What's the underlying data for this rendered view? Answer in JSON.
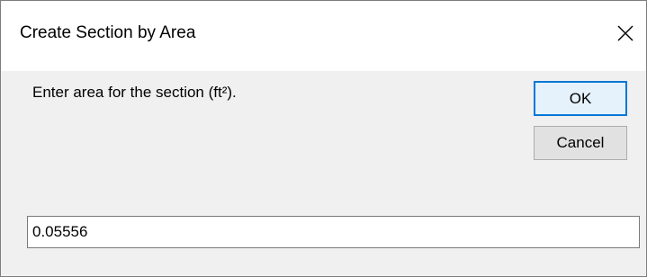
{
  "dialog": {
    "title": "Create Section by Area",
    "close_icon": "close-icon",
    "prompt": "Enter area for the section (ft²).",
    "ok_label": "OK",
    "cancel_label": "Cancel",
    "area_value": "0.05556"
  },
  "colors": {
    "titlebar": "#ffffff",
    "body": "#f0f0f0",
    "default_button_border": "#0078d7",
    "button_face": "#e1e1e1"
  }
}
